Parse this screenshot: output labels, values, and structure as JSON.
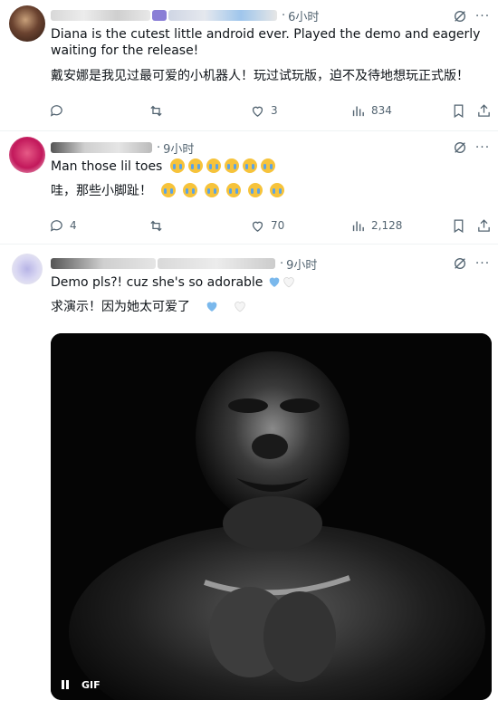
{
  "posts": [
    {
      "time": "6小时",
      "text_en": "Diana is the cutest little android ever. Played the demo and eagerly waiting for the release!",
      "text_zh": "戴安娜是我见过最可爱的小机器人！玩过试玩版，迫不及待地想玩正式版！",
      "stats": {
        "replies": "",
        "reposts": "",
        "likes": "3",
        "views": "834"
      }
    },
    {
      "time": "9小时",
      "text_en": "Man those lil toes",
      "text_zh": "哇，那些小脚趾！",
      "stats": {
        "replies": "4",
        "reposts": "",
        "likes": "70",
        "views": "2,128"
      }
    },
    {
      "time": "9小时",
      "text_en": "Demo pls?! cuz she's so adorable",
      "text_zh": "求演示！因为她太可爱了",
      "media": {
        "badge": "GIF"
      }
    }
  ],
  "colors": {
    "text": "#0f1419",
    "muted": "#536471",
    "divider": "#eff3f4",
    "heart_blue": "#7ab8ec"
  },
  "icons": [
    "grok-icon",
    "more-icon",
    "reply-icon",
    "repost-icon",
    "like-icon",
    "views-icon",
    "bookmark-icon",
    "share-icon",
    "pause-icon"
  ]
}
